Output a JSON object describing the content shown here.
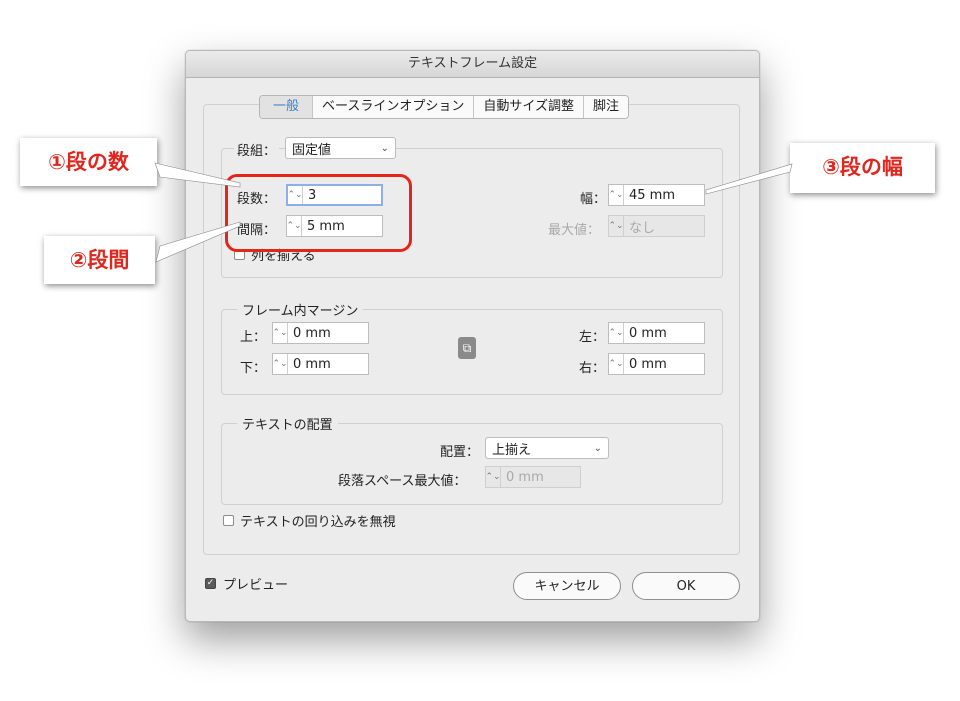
{
  "dialog": {
    "title": "テキストフレーム設定",
    "tabs": [
      {
        "label": "一般",
        "active": true
      },
      {
        "label": "ベースラインオプション",
        "active": false
      },
      {
        "label": "自動サイズ調整",
        "active": false
      },
      {
        "label": "脚注",
        "active": false
      }
    ]
  },
  "columns": {
    "type_label": "段組：",
    "type_value": "固定値",
    "count_label": "段数：",
    "count_value": "3",
    "gutter_label": "間隔：",
    "gutter_value": "5 mm",
    "width_label": "幅：",
    "width_value": "45 mm",
    "max_label": "最大値：",
    "max_value": "なし",
    "balance_label": "列を揃える",
    "balance_checked": false
  },
  "inset": {
    "legend": "フレーム内マージン",
    "top_label": "上：",
    "top_value": "0 mm",
    "bottom_label": "下：",
    "bottom_value": "0 mm",
    "left_label": "左：",
    "left_value": "0 mm",
    "right_label": "右：",
    "right_value": "0 mm",
    "link_icon": "chain-link-icon"
  },
  "vertical": {
    "legend": "テキストの配置",
    "align_label": "配置：",
    "align_value": "上揃え",
    "spacing_label": "段落スペース最大値：",
    "spacing_value": "0 mm"
  },
  "ignore_wrap_label": "テキストの回り込みを無視",
  "ignore_wrap_checked": false,
  "preview_label": "プレビュー",
  "preview_checked": true,
  "buttons": {
    "cancel": "キャンセル",
    "ok": "OK"
  },
  "callouts": {
    "c1": "①段の数",
    "c2": "②段間",
    "c3": "③段の幅"
  },
  "colors": {
    "callout_text": "#e0261d",
    "highlight_ring": "#e2261a",
    "active_tab_text": "#3b7fd4"
  }
}
